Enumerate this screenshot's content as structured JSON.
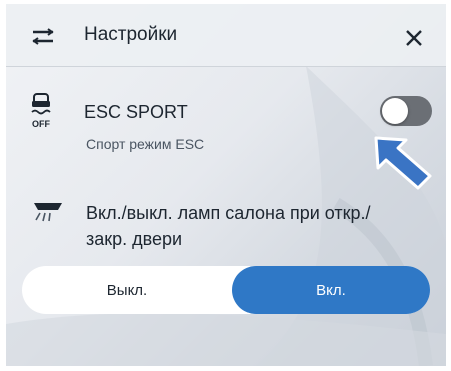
{
  "header": {
    "title": "Настройки",
    "menu_icon": "menu-sliders-icon",
    "close_icon": "close-icon"
  },
  "esc": {
    "title": "ESC SPORT",
    "subtitle": "Спорт режим ESC",
    "icon_label": "OFF",
    "icon": "esc-off-icon",
    "toggle_on": false
  },
  "lamp": {
    "label": "Вкл./выкл. ламп салона при откр./закр. двери",
    "icon": "interior-lamp-icon",
    "options": [
      "Выкл.",
      "Вкл."
    ],
    "selected": "Вкл."
  },
  "colors": {
    "accent": "#2f78c6",
    "arrow": "#3a74c4",
    "toggle_track": "#6b6f75"
  }
}
